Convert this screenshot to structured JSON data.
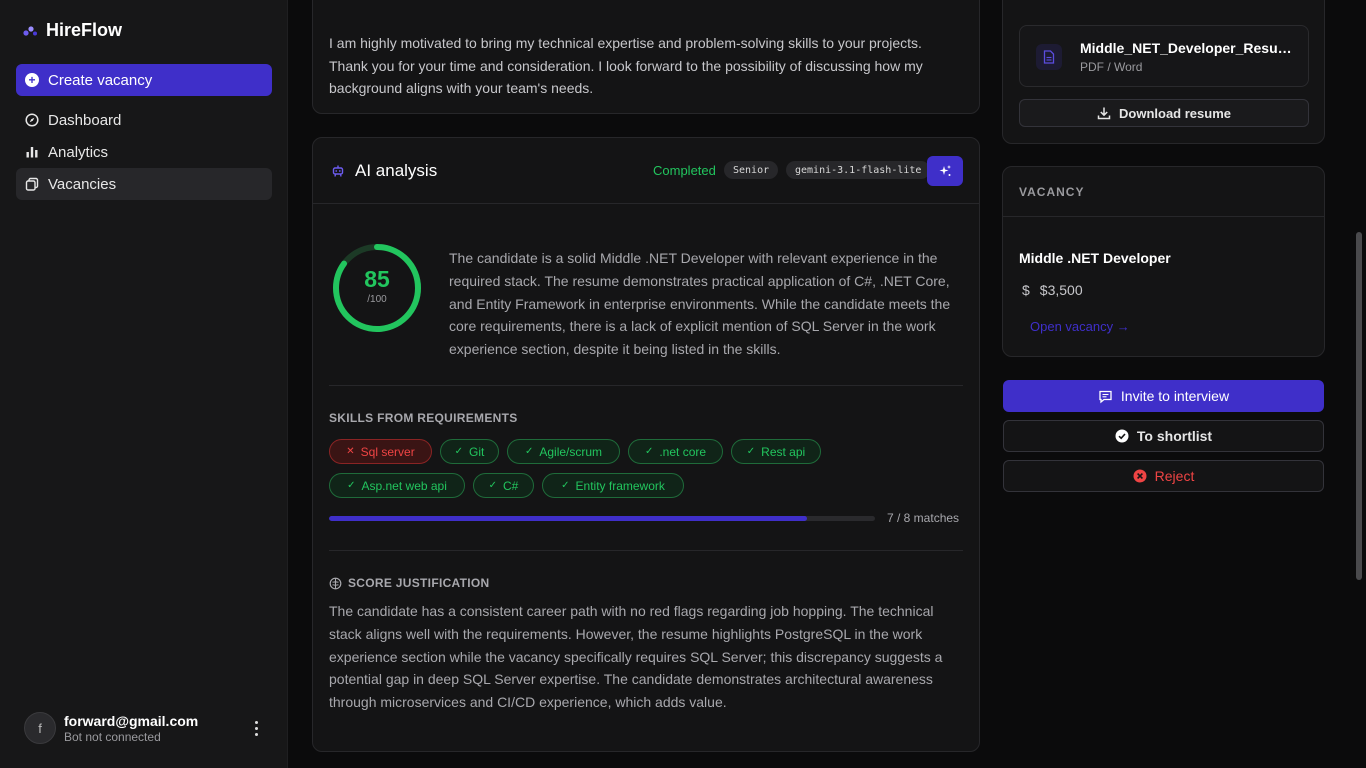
{
  "app": {
    "name": "HireFlow"
  },
  "sidebar": {
    "primary_action": "Create vacancy",
    "items": [
      {
        "label": "Dashboard",
        "icon": "compass-icon"
      },
      {
        "label": "Analytics",
        "icon": "bar-chart-icon"
      },
      {
        "label": "Vacancies",
        "icon": "copy-icon",
        "active": true
      }
    ],
    "user": {
      "initial": "f",
      "email": "forward@gmail.com",
      "status": "Bot not connected"
    }
  },
  "cover_letter": {
    "text": "I am highly motivated to bring my technical expertise and problem-solving skills to your projects. Thank you for your time and consideration. I look forward to the possibility of discussing how my background aligns with your team's needs."
  },
  "ai_analysis": {
    "title": "AI analysis",
    "status": "Completed",
    "level": "Senior",
    "model": "gemini-3.1-flash-lite",
    "score": 85,
    "score_max": "/100",
    "summary": "The candidate is a solid Middle .NET Developer with relevant experience in the required stack. The resume demonstrates practical application of C#, .NET Core, and Entity Framework in enterprise environments. While the candidate meets the core requirements, there is a lack of explicit mention of SQL Server in the work experience section, despite it being listed in the skills.",
    "skills_label": "SKILLS FROM REQUIREMENTS",
    "skills": [
      {
        "name": "Sql server",
        "matched": false
      },
      {
        "name": "Git",
        "matched": true
      },
      {
        "name": "Agile/scrum",
        "matched": true
      },
      {
        "name": ".net core",
        "matched": true
      },
      {
        "name": "Rest api",
        "matched": true
      },
      {
        "name": "Asp.net web api",
        "matched": true
      },
      {
        "name": "C#",
        "matched": true
      },
      {
        "name": "Entity framework",
        "matched": true
      }
    ],
    "match_fraction": 0.875,
    "matches_text": "7 / 8 matches",
    "justification_label": "SCORE JUSTIFICATION",
    "justification": "The candidate has a consistent career path with no red flags regarding job hopping. The technical stack aligns well with the requirements. However, the resume highlights PostgreSQL in the work experience section while the vacancy specifically requires SQL Server; this discrepancy suggests a potential gap in deep SQL Server expertise. The candidate demonstrates architectural awareness through microservices and CI/CD experience, which adds value."
  },
  "resume": {
    "file_name": "Middle_NET_Developer_Resume.pdf",
    "file_type": "PDF / Word",
    "download_label": "Download resume"
  },
  "vacancy": {
    "heading": "VACANCY",
    "title": "Middle .NET Developer",
    "currency_symbol": "$",
    "salary": "$3,500",
    "link": "Open vacancy →"
  },
  "actions": {
    "invite": "Invite to interview",
    "shortlist": "To shortlist",
    "reject": "Reject"
  },
  "colors": {
    "accent": "#3f2fc9",
    "success": "#22c55e",
    "danger": "#ef4444"
  }
}
